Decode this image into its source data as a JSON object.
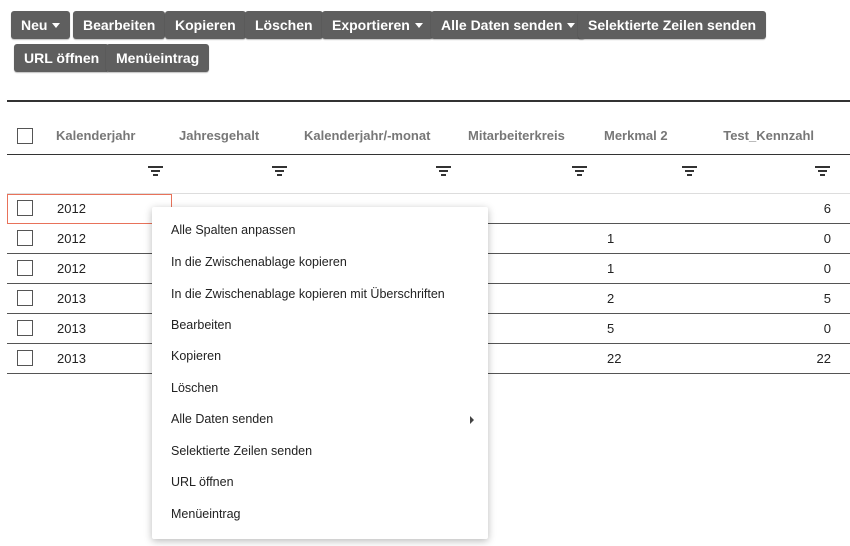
{
  "toolbar": {
    "buttons": [
      {
        "label": "Neu",
        "dropdown": true
      },
      {
        "label": "Bearbeiten",
        "dropdown": false
      },
      {
        "label": "Kopieren",
        "dropdown": false
      },
      {
        "label": "Löschen",
        "dropdown": false
      },
      {
        "label": "Exportieren",
        "dropdown": true
      },
      {
        "label": "Alle Daten senden",
        "dropdown": true
      },
      {
        "label": "Selektierte Zeilen senden",
        "dropdown": false
      },
      {
        "label": "URL öffnen",
        "dropdown": false
      },
      {
        "label": "Menüeintrag",
        "dropdown": false
      }
    ]
  },
  "grid": {
    "columns": [
      "Kalenderjahr",
      "Jahresgehalt",
      "Kalenderjahr/-monat",
      "Mitarbeiterkreis",
      "Merkmal 2",
      "Test_Kennzahl"
    ],
    "rows": [
      {
        "kalenderjahr": "2012",
        "merkmal2": "",
        "kennzahl": "6"
      },
      {
        "kalenderjahr": "2012",
        "merkmal2": "1",
        "kennzahl": "0"
      },
      {
        "kalenderjahr": "2012",
        "merkmal2": "1",
        "kennzahl": "0"
      },
      {
        "kalenderjahr": "2013",
        "merkmal2": "2",
        "kennzahl": "5"
      },
      {
        "kalenderjahr": "2013",
        "merkmal2": "5",
        "kennzahl": "0"
      },
      {
        "kalenderjahr": "2013",
        "merkmal2": "22",
        "kennzahl": "22"
      }
    ]
  },
  "context_menu": {
    "items": [
      {
        "label": "Alle Spalten anpassen",
        "submenu": false
      },
      {
        "label": "In die Zwischenablage kopieren",
        "submenu": false
      },
      {
        "label": "In die Zwischenablage kopieren mit Überschriften",
        "submenu": false
      },
      {
        "label": "Bearbeiten",
        "submenu": false
      },
      {
        "label": "Kopieren",
        "submenu": false
      },
      {
        "label": "Löschen",
        "submenu": false
      },
      {
        "label": "Alle Daten senden",
        "submenu": true
      },
      {
        "label": "Selektierte Zeilen senden",
        "submenu": false
      },
      {
        "label": "URL öffnen",
        "submenu": false
      },
      {
        "label": "Menüeintrag",
        "submenu": false
      }
    ]
  },
  "colors": {
    "button_bg": "#5f5f5f",
    "header_text": "#777777",
    "focus_border": "#e8725a"
  }
}
